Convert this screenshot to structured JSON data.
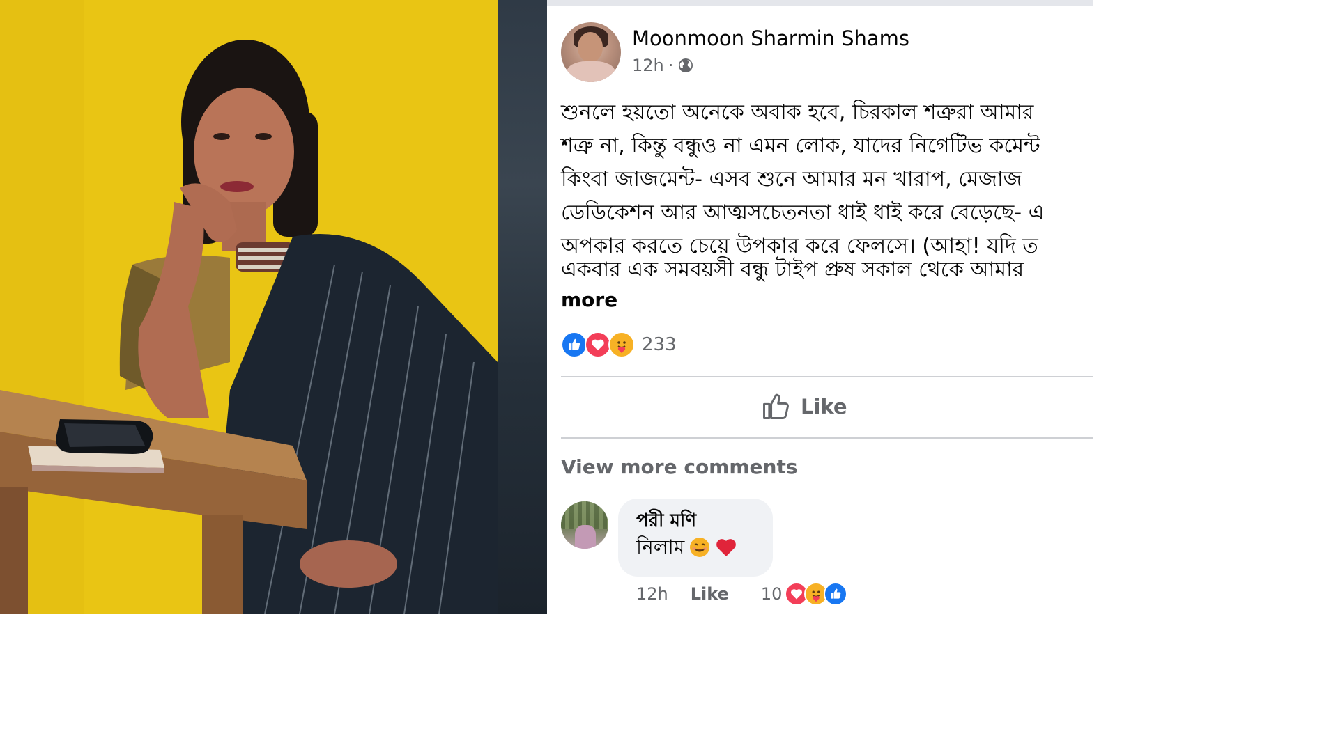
{
  "post": {
    "author": "Moonmoon Sharmin Shams",
    "time": "12h",
    "separator": "·",
    "privacy_icon": "globe-icon",
    "text_lines": [
      "শুনলে হয়তো অনেকে অবাক হবে, চিরকাল শত্রুরা আমার",
      "শত্রু না, কিন্তু বন্ধুও না এমন লোক, যাদের নিগেটিভ কমেন্ট",
      "কিংবা জাজমেন্ট- এসব শুনে আমার মন খারাপ, মেজাজ",
      "ডেডিকেশন আর আত্মসচেতনতা ধাই ধাই করে বেড়েছে- এ",
      "অপকার করতে চেয়ে উপকার করে ফেলসে। (আহা! যদি ত"
    ],
    "second_paragraph": "একবার এক সমবয়সী বন্ধু টাইপ প্রুষ সকাল থেকে আমার",
    "see_more": "more",
    "reaction_count": "233",
    "reaction_icons": [
      "like-icon",
      "love-icon",
      "care-icon"
    ],
    "like_label": "Like",
    "view_more_comments": "View more comments"
  },
  "comment": {
    "author": "পরী মণি",
    "text": "নিলাম",
    "emojis": [
      "smile-emoji",
      "heart-emoji"
    ],
    "time": "12h",
    "like_label": "Like",
    "reaction_count": "10",
    "reaction_icons": [
      "love-icon",
      "care-icon",
      "like-icon"
    ]
  },
  "colors": {
    "background_yellow": "#e8c413",
    "facebook_blue": "#1877f2",
    "love_red": "#f33e58",
    "care_yellow": "#f7b125",
    "secondary_text": "#65676b",
    "comment_bubble": "#f0f2f5"
  }
}
